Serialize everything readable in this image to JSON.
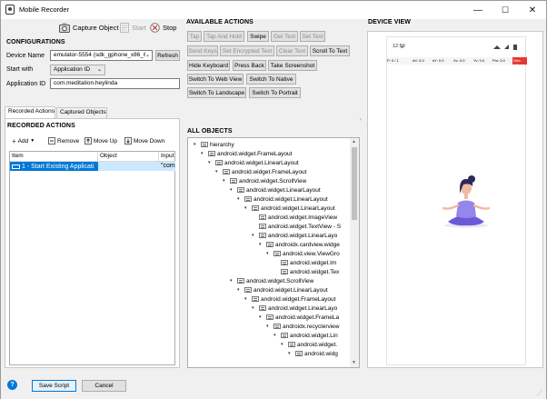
{
  "window": {
    "title": "Mobile Recorder",
    "controls": {
      "minimize": "—",
      "maximize": "☐",
      "close": "✕"
    }
  },
  "toolbar": {
    "capture_label": "Capture Object",
    "start_label": "Start",
    "stop_label": "Stop"
  },
  "configurations": {
    "heading": "CONFIGURATIONS",
    "device_label": "Device Name",
    "device_value": "emulator-5554 (sdk_gphone_x86_6",
    "refresh_label": "Refresh",
    "start_with_label": "Start with",
    "start_with_value": "Application ID",
    "app_id_label": "Application ID",
    "app_id_value": "com.meditation.heylinda"
  },
  "tabs": {
    "recorded": "Recorded Actions",
    "captured": "Captured Objects"
  },
  "recorded_actions": {
    "heading": "RECORDED ACTIONS",
    "add_label": "Add",
    "remove_label": "Remove",
    "move_up_label": "Move Up",
    "move_down_label": "Move Down",
    "columns": [
      "Item",
      "Object",
      "Input"
    ],
    "rows": [
      {
        "item": "1 - Start Existing Applicati",
        "object": "",
        "input": "\"com.m"
      }
    ]
  },
  "available_actions": {
    "heading": "AVAILABLE ACTIONS",
    "buttons": [
      {
        "label": "Tap",
        "enabled": false
      },
      {
        "label": "Tap And Hold",
        "enabled": false
      },
      {
        "label": "Swipe",
        "enabled": true
      },
      {
        "label": "Get Text",
        "enabled": false
      },
      {
        "label": "Set Text",
        "enabled": false
      },
      {
        "label": "Send Keys",
        "enabled": false
      },
      {
        "label": "Set Encrypted Text",
        "enabled": false
      },
      {
        "label": "Clear Text",
        "enabled": false
      },
      {
        "label": "Scroll To Text",
        "enabled": true
      },
      {
        "label": "Hide Keyboard",
        "enabled": true
      },
      {
        "label": "Press Back",
        "enabled": true
      },
      {
        "label": "Take Screenshot",
        "enabled": true
      },
      {
        "label": "Switch To Web View",
        "enabled": true
      },
      {
        "label": "Switch To Native",
        "enabled": true
      },
      {
        "label": "Switch To Landscape",
        "enabled": true
      },
      {
        "label": "Switch To Portrait",
        "enabled": true
      }
    ]
  },
  "all_objects": {
    "heading": "ALL OBJECTS",
    "nodes": [
      {
        "label": "hierarchy"
      },
      {
        "label": "android.widget.FrameLayout"
      },
      {
        "label": "android.widget.LinearLayout"
      },
      {
        "label": "android.widget.FrameLayout"
      },
      {
        "label": "android.widget.ScrollView"
      },
      {
        "label": "android.widget.LinearLayout"
      },
      {
        "label": "android.widget.LinearLayout"
      },
      {
        "label": "android.widget.LinearLayout"
      },
      {
        "label": "android.widget.ImageView"
      },
      {
        "label": "android.widget.TextView - S"
      },
      {
        "label": "android.widget.LinearLayo"
      },
      {
        "label": "androidx.cardview.widge"
      },
      {
        "label": "android.view.ViewGro"
      },
      {
        "label": "android.widget.Im"
      },
      {
        "label": "android.widget.Tex"
      },
      {
        "label": "android.widget.ScrollView"
      },
      {
        "label": "android.widget.LinearLayout"
      },
      {
        "label": "android.widget.FrameLayout"
      },
      {
        "label": "android.widget.LinearLayo"
      },
      {
        "label": "android.widget.FrameLa"
      },
      {
        "label": "androidx.recyclerview"
      },
      {
        "label": "android.widget.Lin"
      },
      {
        "label": "android.widget."
      },
      {
        "label": "android.widg"
      }
    ]
  },
  "device_view": {
    "heading": "DEVICE VIEW",
    "status_time": "12:59",
    "sensor_labels": [
      "P: 0 / 1",
      "dX: 0.0",
      "dY: 0.0",
      "Xv: 0.0",
      "Yv: 0.0",
      "Prs: 0.0",
      "Size: 1.0"
    ]
  },
  "footer": {
    "help_icon": "?",
    "save_label": "Save Script",
    "cancel_label": "Cancel"
  },
  "colors": {
    "selection": "#cce8ff",
    "accent": "#0078d7",
    "yoga_purple": "#6a5ad8",
    "hair": "#2d2a55",
    "skin": "#f3b9a0"
  }
}
